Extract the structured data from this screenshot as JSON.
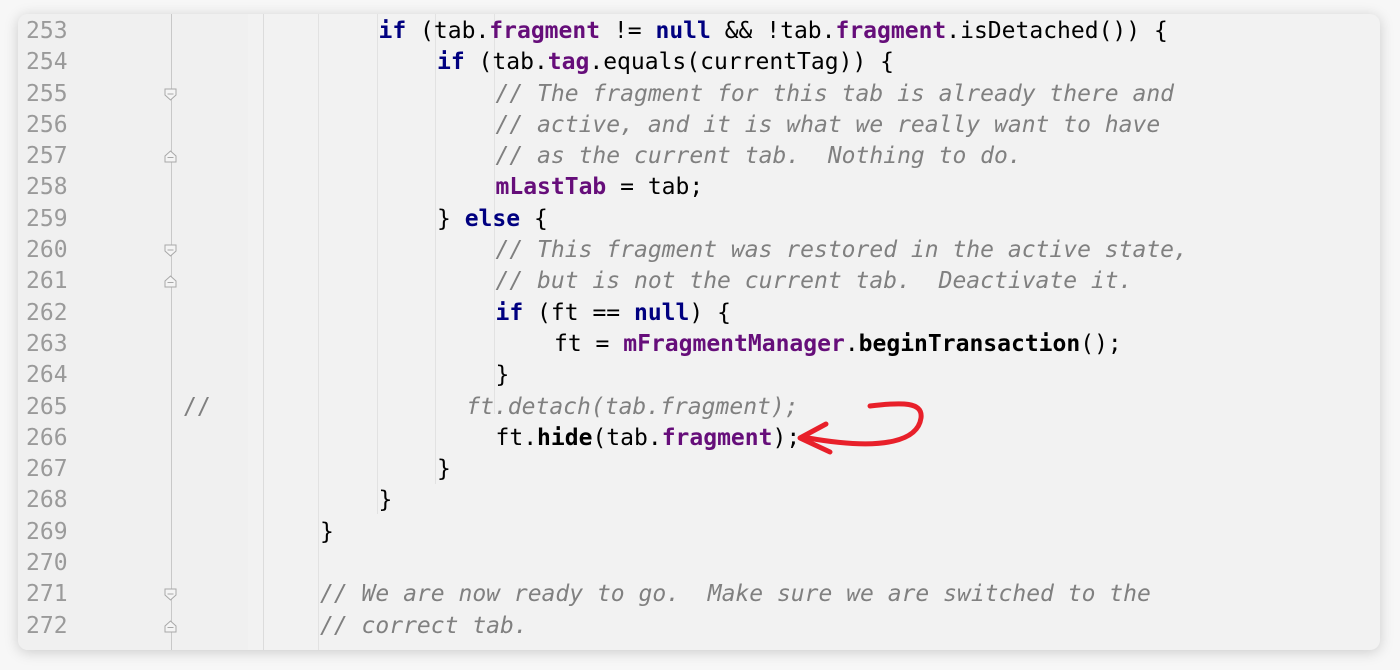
{
  "editor": {
    "lines": [
      {
        "n": "253",
        "indent": 3,
        "fold": "",
        "gutter": "",
        "tokens": [
          {
            "t": "kw",
            "v": "if"
          },
          {
            "t": "",
            "v": " (tab."
          },
          {
            "t": "fld",
            "v": "fragment"
          },
          {
            "t": "",
            "v": " != "
          },
          {
            "t": "kw",
            "v": "null"
          },
          {
            "t": "",
            "v": " && !tab."
          },
          {
            "t": "fld",
            "v": "fragment"
          },
          {
            "t": "",
            "v": ".isDetached()) {"
          }
        ]
      },
      {
        "n": "254",
        "indent": 4,
        "fold": "",
        "gutter": "",
        "tokens": [
          {
            "t": "kw",
            "v": "if"
          },
          {
            "t": "",
            "v": " (tab."
          },
          {
            "t": "fld",
            "v": "tag"
          },
          {
            "t": "",
            "v": ".equals(currentTag)) {"
          }
        ]
      },
      {
        "n": "255",
        "indent": 5,
        "fold": "open",
        "gutter": "",
        "tokens": [
          {
            "t": "cmt",
            "v": "// The fragment for this tab is already there and"
          }
        ]
      },
      {
        "n": "256",
        "indent": 5,
        "fold": "",
        "gutter": "",
        "tokens": [
          {
            "t": "cmt",
            "v": "// active, and it is what we really want to have"
          }
        ]
      },
      {
        "n": "257",
        "indent": 5,
        "fold": "close",
        "gutter": "",
        "tokens": [
          {
            "t": "cmt",
            "v": "// as the current tab.  Nothing to do."
          }
        ]
      },
      {
        "n": "258",
        "indent": 5,
        "fold": "",
        "gutter": "",
        "tokens": [
          {
            "t": "fld",
            "v": "mLastTab"
          },
          {
            "t": "",
            "v": " = tab;"
          }
        ]
      },
      {
        "n": "259",
        "indent": 4,
        "fold": "",
        "gutter": "",
        "tokens": [
          {
            "t": "",
            "v": "} "
          },
          {
            "t": "kw",
            "v": "else"
          },
          {
            "t": "",
            "v": " {"
          }
        ]
      },
      {
        "n": "260",
        "indent": 5,
        "fold": "open",
        "gutter": "",
        "tokens": [
          {
            "t": "cmt",
            "v": "// This fragment was restored in the active state,"
          }
        ]
      },
      {
        "n": "261",
        "indent": 5,
        "fold": "close",
        "gutter": "",
        "tokens": [
          {
            "t": "cmt",
            "v": "// but is not the current tab.  Deactivate it."
          }
        ]
      },
      {
        "n": "262",
        "indent": 5,
        "fold": "",
        "gutter": "",
        "tokens": [
          {
            "t": "kw",
            "v": "if"
          },
          {
            "t": "",
            "v": " (ft == "
          },
          {
            "t": "kw",
            "v": "null"
          },
          {
            "t": "",
            "v": ") {"
          }
        ]
      },
      {
        "n": "263",
        "indent": 6,
        "fold": "",
        "gutter": "",
        "tokens": [
          {
            "t": "",
            "v": "ft = "
          },
          {
            "t": "fld",
            "v": "mFragmentManager"
          },
          {
            "t": "",
            "v": "."
          },
          {
            "t": "mth",
            "v": "beginTransaction"
          },
          {
            "t": "",
            "v": "();"
          }
        ]
      },
      {
        "n": "264",
        "indent": 5,
        "fold": "",
        "gutter": "",
        "tokens": [
          {
            "t": "",
            "v": "}"
          }
        ]
      },
      {
        "n": "265",
        "indent": 4.5,
        "fold": "",
        "gutter": "//",
        "tokens": [
          {
            "t": "cmt",
            "v": "ft.detach(tab.fragment);"
          }
        ]
      },
      {
        "n": "266",
        "indent": 5,
        "fold": "",
        "gutter": "",
        "tokens": [
          {
            "t": "",
            "v": "ft."
          },
          {
            "t": "mth",
            "v": "hide"
          },
          {
            "t": "",
            "v": "(tab."
          },
          {
            "t": "fld",
            "v": "fragment"
          },
          {
            "t": "",
            "v": ");"
          }
        ]
      },
      {
        "n": "267",
        "indent": 4,
        "fold": "",
        "gutter": "",
        "tokens": [
          {
            "t": "",
            "v": "}"
          }
        ]
      },
      {
        "n": "268",
        "indent": 3,
        "fold": "",
        "gutter": "",
        "tokens": [
          {
            "t": "",
            "v": "}"
          }
        ]
      },
      {
        "n": "269",
        "indent": 2,
        "fold": "",
        "gutter": "",
        "tokens": [
          {
            "t": "",
            "v": "}"
          }
        ]
      },
      {
        "n": "270",
        "indent": 2,
        "fold": "",
        "gutter": "",
        "tokens": []
      },
      {
        "n": "271",
        "indent": 2,
        "fold": "open",
        "gutter": "",
        "tokens": [
          {
            "t": "cmt",
            "v": "// We are now ready to go.  Make sure we are switched to the"
          }
        ]
      },
      {
        "n": "272",
        "indent": 2,
        "fold": "close",
        "gutter": "",
        "tokens": [
          {
            "t": "cmt",
            "v": "// correct tab."
          }
        ]
      }
    ]
  },
  "annotation": {
    "color": "#e8202a",
    "shape": "curved-arrow"
  },
  "colors": {
    "keyword": "#000080",
    "field": "#660e7a",
    "comment": "#808080",
    "line_number": "#9a9a9a"
  }
}
